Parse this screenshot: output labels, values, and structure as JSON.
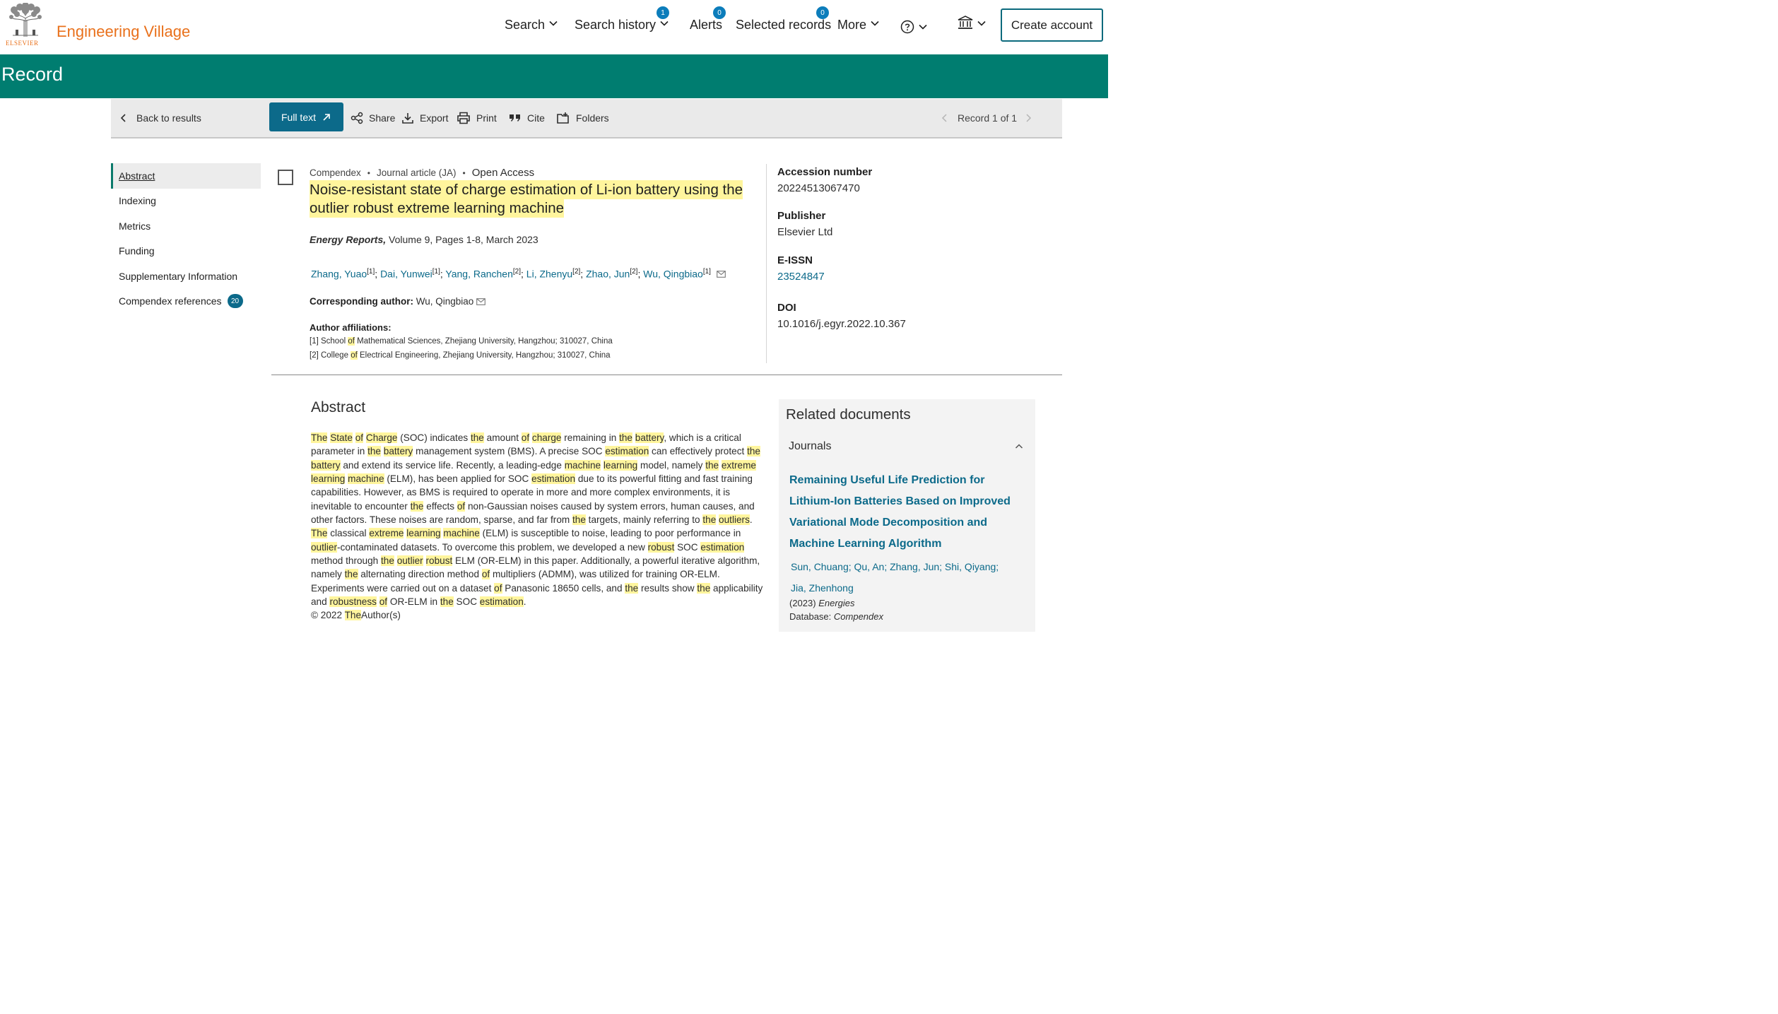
{
  "brand": {
    "publisher": "ELSEVIER",
    "name": "Engineering Village"
  },
  "nav": {
    "search": "Search",
    "search_history": "Search history",
    "search_history_count": "1",
    "alerts": "Alerts",
    "alerts_count": "0",
    "selected_records": "Selected records",
    "selected_count": "0",
    "more": "More",
    "create_account": "Create account"
  },
  "page_title": "Record",
  "toolbar": {
    "back": "Back to results",
    "full_text": "Full text",
    "share": "Share",
    "export": "Export",
    "print": "Print",
    "cite": "Cite",
    "folders": "Folders",
    "record_position": "Record 1 of 1"
  },
  "sidenav": {
    "items": [
      "Abstract",
      "Indexing",
      "Metrics",
      "Funding",
      "Supplementary Information",
      "Compendex references"
    ],
    "references_count": "20"
  },
  "record": {
    "database": "Compendex",
    "doc_type": "Journal article (JA)",
    "access": "Open Access",
    "title_line1": "Noise-resistant state of charge estimation of Li-ion battery using the",
    "title_line2": "outlier robust extreme learning machine",
    "journal_name": "Energy Reports,",
    "journal_details": "Volume 9, Pages 1-8, March 2023",
    "authors": [
      {
        "name": "Zhang, Yuao",
        "aff": "[1]"
      },
      {
        "name": "Dai, Yunwei",
        "aff": "[1]"
      },
      {
        "name": "Yang, Ranchen",
        "aff": "[2]"
      },
      {
        "name": "Li, Zhenyu",
        "aff": "[2]"
      },
      {
        "name": "Zhao, Jun",
        "aff": "[2]"
      },
      {
        "name": "Wu, Qingbiao",
        "aff": "[1]"
      }
    ],
    "corresponding_label": "Corresponding author:",
    "corresponding_name": "Wu, Qingbiao",
    "affiliations_label": "Author affiliations:",
    "affiliation1_pre": "[1] School",
    "affiliation1_of": "of",
    "affiliation1_post": "Mathematical Sciences, Zhejiang University, Hangzhou; 310027, China",
    "affiliation2_pre": "[2] College",
    "affiliation2_of": "of",
    "affiliation2_post": "Electrical Engineering, Zhejiang University, Hangzhou; 310027, China"
  },
  "record_info": {
    "accession_label": "Accession number",
    "accession": "20224513067470",
    "publisher_label": "Publisher",
    "publisher": "Elsevier Ltd",
    "eissn_label": "E-ISSN",
    "eissn": "23524847",
    "doi_label": "DOI",
    "doi": "10.1016/j.egyr.2022.10.367"
  },
  "abstract": {
    "heading": "Abstract",
    "segments": [
      [
        "The",
        true
      ],
      [
        " ",
        false
      ],
      [
        "State",
        true
      ],
      [
        " ",
        false
      ],
      [
        "of",
        true
      ],
      [
        " ",
        false
      ],
      [
        "Charge",
        true
      ],
      [
        " (SOC) indicates ",
        false
      ],
      [
        "the",
        true
      ],
      [
        " amount ",
        false
      ],
      [
        "of",
        true
      ],
      [
        " ",
        false
      ],
      [
        "charge",
        true
      ],
      [
        " remaining in ",
        false
      ],
      [
        "the",
        true
      ],
      [
        " ",
        false
      ],
      [
        "battery",
        true
      ],
      [
        ", which is a critical parameter in ",
        false
      ],
      [
        "the",
        true
      ],
      [
        " ",
        false
      ],
      [
        "battery",
        true
      ],
      [
        " management system (BMS). A precise SOC ",
        false
      ],
      [
        "estimation",
        true
      ],
      [
        " can effectively protect ",
        false
      ],
      [
        "the",
        true
      ],
      [
        " ",
        false
      ],
      [
        "battery",
        true
      ],
      [
        " and extend its service life. Recently, a leading-edge ",
        false
      ],
      [
        "machine",
        true
      ],
      [
        " ",
        false
      ],
      [
        "learning",
        true
      ],
      [
        " model, namely ",
        false
      ],
      [
        "the",
        true
      ],
      [
        " ",
        false
      ],
      [
        "extreme",
        true
      ],
      [
        " ",
        false
      ],
      [
        "learning",
        true
      ],
      [
        " ",
        false
      ],
      [
        "machine",
        true
      ],
      [
        " (ELM), has been applied for SOC ",
        false
      ],
      [
        "estimation",
        true
      ],
      [
        " due to its powerful fitting and fast training capabilities. However, as BMS is required to operate in more and more complex environments, it is inevitable to encounter ",
        false
      ],
      [
        "the",
        true
      ],
      [
        " effects ",
        false
      ],
      [
        "of",
        true
      ],
      [
        " non-Gaussian noises caused by system errors, human causes, and other factors. These noises are random, sparse, and far from ",
        false
      ],
      [
        "the",
        true
      ],
      [
        " targets, mainly referring to ",
        false
      ],
      [
        "the",
        true
      ],
      [
        " ",
        false
      ],
      [
        "outliers",
        true
      ],
      [
        ". ",
        false
      ],
      [
        "The",
        true
      ],
      [
        " classical ",
        false
      ],
      [
        "extreme",
        true
      ],
      [
        " ",
        false
      ],
      [
        "learning",
        true
      ],
      [
        " ",
        false
      ],
      [
        "machine",
        true
      ],
      [
        " (ELM) is susceptible to noise, leading to poor performance in ",
        false
      ],
      [
        "outlier",
        true
      ],
      [
        "-contaminated datasets. To overcome this problem, we developed a new ",
        false
      ],
      [
        "robust",
        true
      ],
      [
        " SOC ",
        false
      ],
      [
        "estimation",
        true
      ],
      [
        " method through ",
        false
      ],
      [
        "the",
        true
      ],
      [
        " ",
        false
      ],
      [
        "outlier",
        true
      ],
      [
        " ",
        false
      ],
      [
        "robust",
        true
      ],
      [
        " ELM (OR-ELM) in this paper. Additionally, a powerful iterative algorithm, namely ",
        false
      ],
      [
        "the",
        true
      ],
      [
        " alternating direction method ",
        false
      ],
      [
        "of",
        true
      ],
      [
        " multipliers (ADMM), was utilized for training OR-ELM. Experiments were carried out on a dataset ",
        false
      ],
      [
        "of",
        true
      ],
      [
        " Panasonic 18650 cells, and ",
        false
      ],
      [
        "the",
        true
      ],
      [
        " results show ",
        false
      ],
      [
        "the",
        true
      ],
      [
        " applicability and ",
        false
      ],
      [
        "robustness",
        true
      ],
      [
        " ",
        false
      ],
      [
        "of",
        true
      ],
      [
        " OR-ELM in ",
        false
      ],
      [
        "the",
        true
      ],
      [
        " SOC ",
        false
      ],
      [
        "estimation",
        true
      ],
      [
        ".",
        false
      ]
    ],
    "copyright_pre": "© 2022",
    "copyright_the": "The",
    "copyright_post": "Author(s)"
  },
  "related": {
    "heading": "Related documents",
    "tab": "Journals",
    "title": "Remaining Useful Life Prediction for Lithium-Ion Batteries Based on Improved Variational Mode Decomposition and Machine Learning Algorithm",
    "authors_line1": "Sun, Chuang;  Qu, An;  Zhang, Jun; Shi, Qiyang;",
    "authors_line2": "Jia, Zhenhong",
    "year": "(2023)",
    "source": "Energies",
    "db_label": "Database:",
    "db": "Compendex"
  }
}
